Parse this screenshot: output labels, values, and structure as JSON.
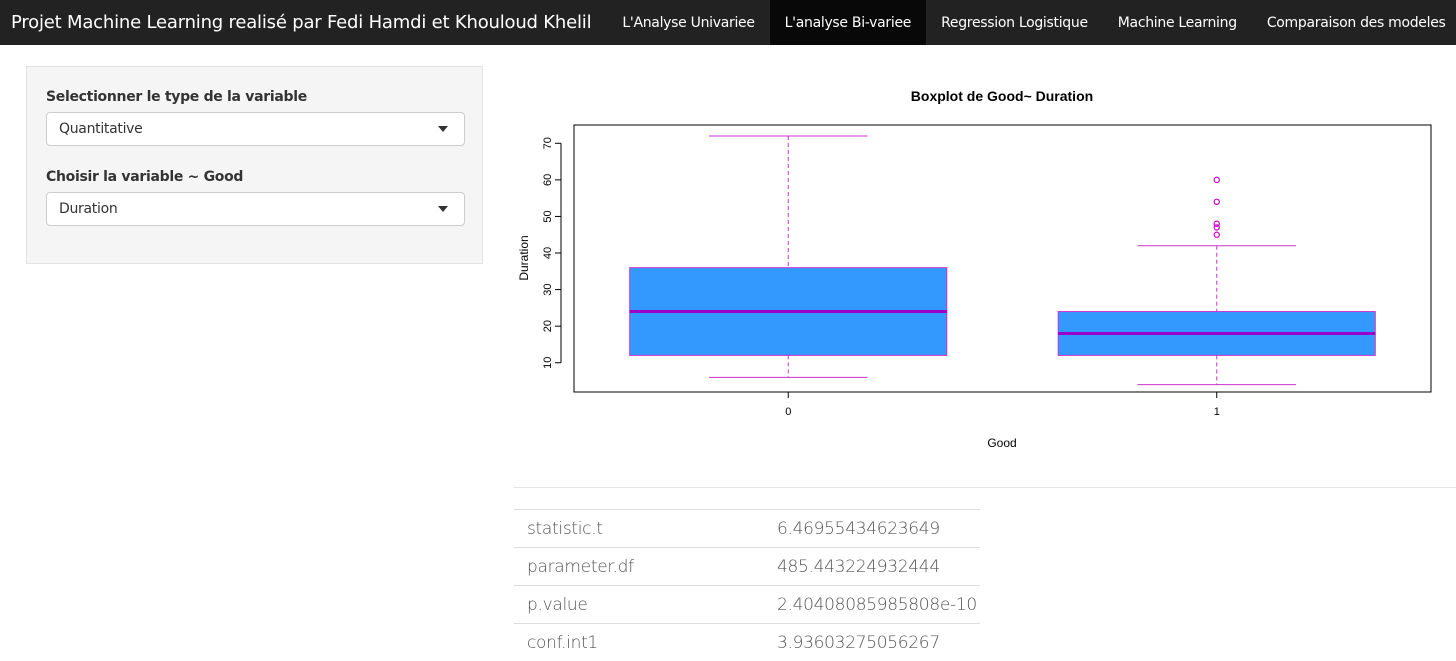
{
  "navbar": {
    "brand": "Projet Machine Learning realisé par Fedi Hamdi et Khouloud Khelil",
    "tabs": [
      {
        "label": "L'Analyse Univariee",
        "active": false
      },
      {
        "label": "L'analyse Bi-variee",
        "active": true
      },
      {
        "label": "Regression Logistique",
        "active": false
      },
      {
        "label": "Machine Learning",
        "active": false
      },
      {
        "label": "Comparaison des modeles",
        "active": false
      }
    ]
  },
  "sidebar": {
    "type_label": "Selectionner le type de la variable",
    "type_value": "Quantitative",
    "var_label": "Choisir la variable ~ Good",
    "var_value": "Duration"
  },
  "chart_data": {
    "type": "boxplot",
    "title": "Boxplot de  Good~ Duration",
    "xlabel": "Good",
    "ylabel": "Duration",
    "categories": [
      "0",
      "1"
    ],
    "yticks": [
      10,
      20,
      30,
      40,
      50,
      60,
      70
    ],
    "ylim": [
      2,
      75
    ],
    "boxes": [
      {
        "category": "0",
        "min": 6,
        "q1": 12,
        "median": 24,
        "q3": 36,
        "max": 72,
        "outliers": []
      },
      {
        "category": "1",
        "min": 4,
        "q1": 12,
        "median": 18,
        "q3": 24,
        "max": 42,
        "outliers": [
          45,
          47,
          48,
          54,
          60
        ]
      }
    ],
    "colors": {
      "box_fill": "#3399ff",
      "box_border": "#cc33cc",
      "median": "#9900cc",
      "outlier": "#cc00cc"
    }
  },
  "stats": [
    {
      "name": "statistic.t",
      "value": "6.46955434623649"
    },
    {
      "name": "parameter.df",
      "value": "485.443224932444"
    },
    {
      "name": "p.value",
      "value": "2.40408085985808e-10"
    },
    {
      "name": "conf.int1",
      "value": "3.93603275056267"
    }
  ]
}
